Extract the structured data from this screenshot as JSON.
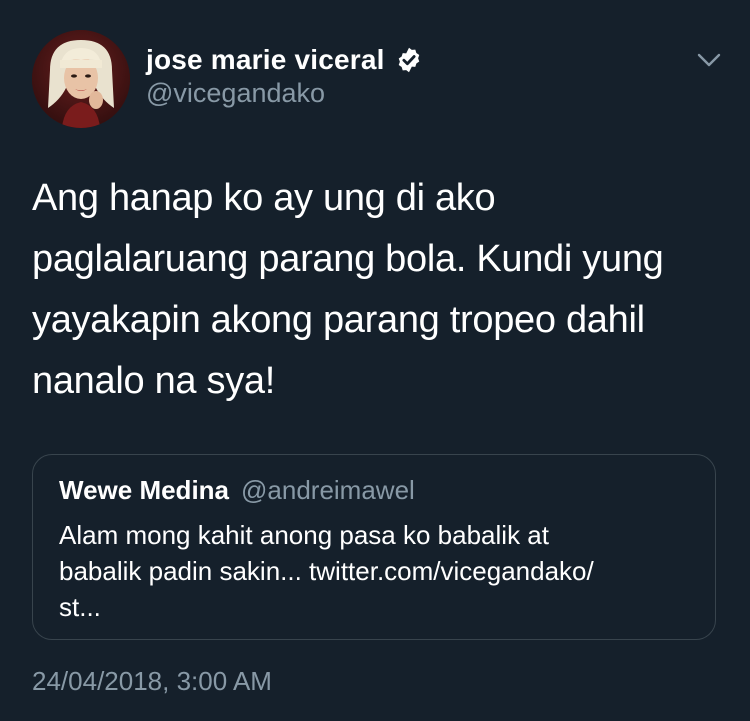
{
  "tweet": {
    "author": {
      "display_name": "jose marie viceral",
      "handle": "@vicegandako",
      "verified": true,
      "avatar_icon": "profile-avatar"
    },
    "menu_icon": "chevron-down-icon",
    "text": "Ang hanap ko ay ung di ako\npaglalaruang parang bola. Kundi yung\nyayakapin akong parang tropeo dahil\nnanalo na sya!",
    "quoted_tweet": {
      "display_name": "Wewe Medina",
      "handle": "@andreimawel",
      "text": "Alam mong kahit anong pasa ko babalik at\nbabalik padin sakin... twitter.com/vicegandako/\nst..."
    },
    "timestamp": "24/04/2018, 3:00 AM"
  },
  "colors": {
    "background": "#15202b",
    "text_primary": "#ffffff",
    "text_secondary": "#8899a6",
    "border": "#38444d"
  }
}
